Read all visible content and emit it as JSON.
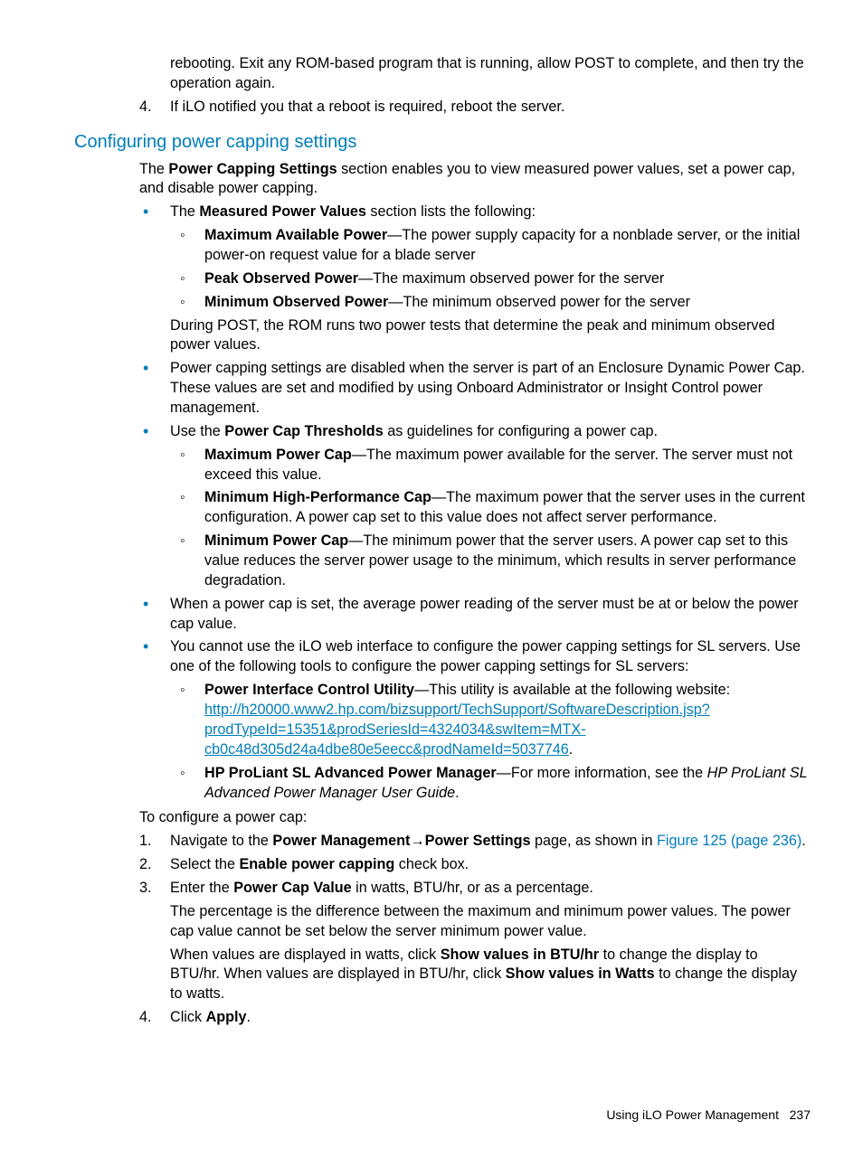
{
  "intro": {
    "para1": "rebooting. Exit any ROM-based program that is running, allow POST to complete, and then try the operation again.",
    "item4_num": "4.",
    "item4": "If iLO notified you that a reboot is required, reboot the server."
  },
  "heading": "Configuring power capping settings",
  "p1_a": "The ",
  "p1_b": "Power Capping Settings",
  "p1_c": " section enables you to view measured power values, set a power cap, and disable power capping.",
  "b1_a": "The ",
  "b1_b": "Measured Power Values",
  "b1_c": " section lists the following:",
  "b1_s1_a": "Maximum Available Power",
  "b1_s1_b": "—The power supply capacity for a nonblade server, or the initial power-on request value for a blade server",
  "b1_s2_a": "Peak Observed Power",
  "b1_s2_b": "—The maximum observed power for the server",
  "b1_s3_a": "Minimum Observed Power",
  "b1_s3_b": "—The minimum observed power for the server",
  "b1_tail": "During POST, the ROM runs two power tests that determine the peak and minimum observed power values.",
  "b2": "Power capping settings are disabled when the server is part of an Enclosure Dynamic Power Cap. These values are set and modified by using Onboard Administrator or Insight Control power management.",
  "b3_a": "Use the ",
  "b3_b": "Power Cap Thresholds",
  "b3_c": " as guidelines for configuring a power cap.",
  "b3_s1_a": "Maximum Power Cap",
  "b3_s1_b": "—The maximum power available for the server. The server must not exceed this value.",
  "b3_s2_a": "Minimum High-Performance Cap",
  "b3_s2_b": "—The maximum power that the server uses in the current configuration. A power cap set to this value does not affect server performance.",
  "b3_s3_a": "Minimum Power Cap",
  "b3_s3_b": "—The minimum power that the server users. A power cap set to this value reduces the server power usage to the minimum, which results in server performance degradation.",
  "b4": "When a power cap is set, the average power reading of the server must be at or below the power cap value.",
  "b5": "You cannot use the iLO web interface to configure the power capping settings for SL servers. Use one of the following tools to configure the power capping settings for SL servers:",
  "b5_s1_a": "Power Interface Control Utility",
  "b5_s1_b": "—This utility is available at the following website: ",
  "b5_s1_link": "http://h20000.www2.hp.com/bizsupport/TechSupport/SoftwareDescription.jsp?prodTypeId=15351&prodSeriesId=4324034&swItem=MTX-cb0c48d305d24a4dbe80e5eecc&prodNameId=5037746",
  "b5_s1_c": ".",
  "b5_s2_a": "HP ProLiant SL Advanced Power Manager",
  "b5_s2_b": "—For more information, see the ",
  "b5_s2_i": "HP ProLiant SL Advanced Power Manager User Guide",
  "b5_s2_c": ".",
  "config_intro": "To configure a power cap:",
  "step1_num": "1.",
  "step1_a": "Navigate to the ",
  "step1_b": "Power Management",
  "step1_arrow": "→",
  "step1_c": "Power Settings",
  "step1_d": " page, as shown in ",
  "step1_link": "Figure 125 (page 236)",
  "step1_e": ".",
  "step2_num": "2.",
  "step2_a": "Select the ",
  "step2_b": "Enable power capping",
  "step2_c": " check box.",
  "step3_num": "3.",
  "step3_a": "Enter the ",
  "step3_b": "Power Cap Value",
  "step3_c": " in watts, BTU/hr, or as a percentage.",
  "step3_p1": "The percentage is the difference between the maximum and minimum power values. The power cap value cannot be set below the server minimum power value.",
  "step3_p2_a": "When values are displayed in watts, click ",
  "step3_p2_b": "Show values in BTU/hr",
  "step3_p2_c": " to change the display to BTU/hr. When values are displayed in BTU/hr, click ",
  "step3_p2_d": "Show values in Watts",
  "step3_p2_e": " to change the display to watts.",
  "step4_num": "4.",
  "step4_a": "Click ",
  "step4_b": "Apply",
  "step4_c": ".",
  "footer_text": "Using iLO Power Management",
  "footer_page": "237"
}
